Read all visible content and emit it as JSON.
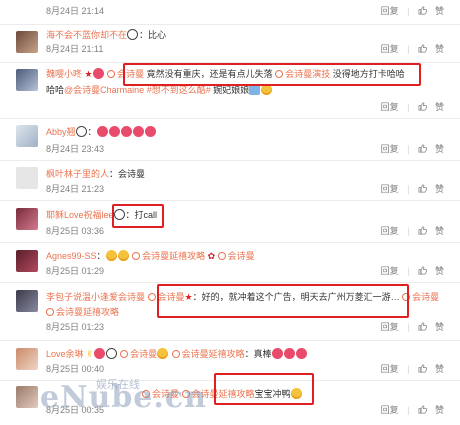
{
  "actions": {
    "reply": "回复",
    "like": "赞"
  },
  "rows": [
    {
      "date": "8月24日 21:14"
    },
    {
      "user": "海不会不蓝你却不在",
      "emoji_desc": "panda",
      "text": "：比心",
      "date": "8月24日 21:11"
    },
    {
      "user": "魏嘤小咚",
      "text_parts": [
        "会诗曼",
        "竟然没有重庆，还是有点儿失落",
        "会诗曼演技",
        "没得地方打卡哈哈",
        "哈哈",
        "会诗曼Charmaine",
        "#想不到这么酷#",
        "婉妃娘娘"
      ],
      "date": ""
    },
    {
      "user": "Abby翘",
      "date": "8月24日 23:43"
    },
    {
      "user": "枫叶林子里的人",
      "text": "：会诗曼",
      "date": "8月24日 21:23"
    },
    {
      "user": "耶稣Love祝福lee",
      "text": "：打call",
      "date": "8月25日 03:36"
    },
    {
      "user": "Agnes99-SS",
      "tags": [
        "会诗曼延禧攻略",
        "会诗曼"
      ],
      "date": "8月25日 01:29"
    },
    {
      "user": "李包子说温小逢爱会诗曼",
      "tag1": "会诗曼",
      "text": "：好的，就冲着这个广告，明天去广州万菱汇一游…",
      "tag2": "会诗曼",
      "tag3": "会诗曼延禧攻略",
      "date": "8月25日 01:23"
    },
    {
      "user": "Love余琳",
      "tags": [
        "会诗曼",
        "会诗曼延禧攻略"
      ],
      "text": "：真棒",
      "date": "8月25日 00:40"
    },
    {
      "tags": [
        "会诗曼",
        "会诗曼延禧攻略"
      ],
      "text": "宝宝冲鸭",
      "date": "8月25日 00:35"
    }
  ],
  "watermark": {
    "main": "eNube.cn",
    "sub": "娱乐在线"
  },
  "colors": {
    "accent": "#eb7350",
    "highlight": "#e02020",
    "muted": "#808080"
  }
}
